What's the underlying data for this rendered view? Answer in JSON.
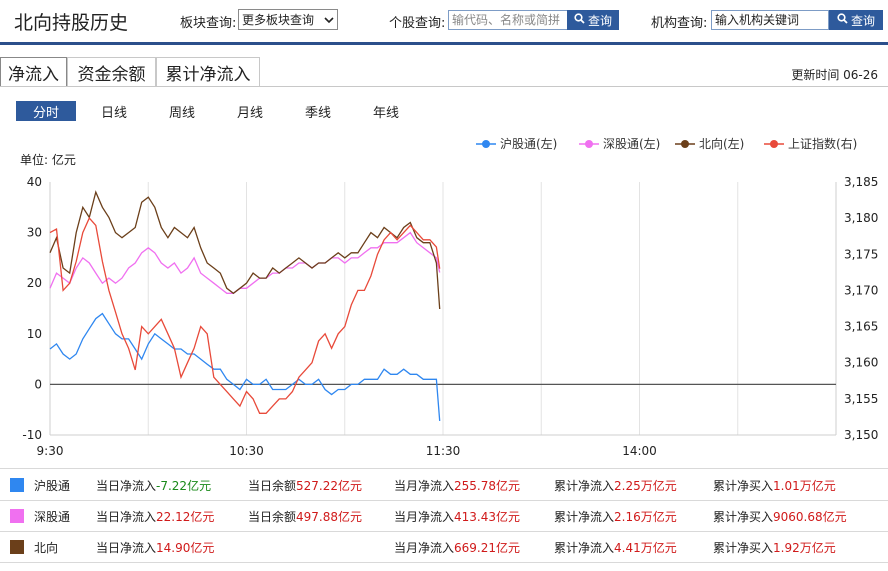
{
  "header": {
    "title": "北向持股历史",
    "sector_label": "板块查询:",
    "sector_value": "更多板块查询",
    "stock_label": "个股查询:",
    "stock_placeholder": "输代码、名称或简拼",
    "search_label": "查询",
    "inst_label": "机构查询:",
    "inst_placeholder": "输入机构关键词",
    "inst_search_label": "查询"
  },
  "tabs": [
    "净流入",
    "资金余额",
    "累计净流入"
  ],
  "update_time": "更新时间 06-26",
  "periods": [
    "分时",
    "日线",
    "周线",
    "月线",
    "季线",
    "年线"
  ],
  "legend": [
    "沪股通(左)",
    "深股通(左)",
    "北向(左)",
    "上证指数(右)"
  ],
  "colors": {
    "sh": "#2f87f0",
    "sz": "#f070f0",
    "north": "#6b3f1a",
    "index": "#e84a3a"
  },
  "chart_data": {
    "type": "line",
    "unit_label": "单位: 亿元",
    "left_ylim": [
      -10,
      40
    ],
    "left_ticks": [
      40,
      30,
      20,
      10,
      0,
      -10
    ],
    "right_ylim": [
      3150,
      3185
    ],
    "right_ticks": [
      "3,185",
      "3,180",
      "3,175",
      "3,170",
      "3,165",
      "3,160",
      "3,155",
      "3,150"
    ],
    "x_ticks": [
      "9:30",
      "10:30",
      "11:30",
      "14:00"
    ],
    "x_minutes_total": 240,
    "series": [
      {
        "name": "沪股通(左)",
        "axis": "left",
        "color_key": "sh",
        "x": [
          0,
          2,
          4,
          6,
          8,
          10,
          12,
          14,
          16,
          18,
          20,
          22,
          24,
          26,
          28,
          30,
          32,
          34,
          36,
          38,
          40,
          42,
          44,
          46,
          48,
          50,
          52,
          54,
          56,
          58,
          60,
          62,
          64,
          66,
          68,
          70,
          72,
          74,
          76,
          78,
          80,
          82,
          84,
          86,
          88,
          90,
          92,
          94,
          96,
          98,
          100,
          102,
          104,
          106,
          108,
          110,
          112,
          114,
          116,
          118,
          119
        ],
        "values": [
          7,
          8,
          6,
          5,
          6,
          9,
          11,
          13,
          14,
          12,
          10,
          9,
          9,
          7,
          5,
          8,
          10,
          9,
          8,
          7,
          7,
          6,
          6,
          5,
          4,
          3,
          3,
          1,
          0,
          -1,
          1,
          0,
          0,
          1,
          -1,
          -1,
          -1,
          0,
          1,
          0,
          0,
          1,
          -1,
          -2,
          -1,
          -1,
          0,
          0,
          1,
          1,
          1,
          3,
          2,
          2,
          3,
          2,
          2,
          1,
          1,
          1,
          -7.22
        ]
      },
      {
        "name": "深股通(左)",
        "axis": "left",
        "color_key": "sz",
        "x": [
          0,
          2,
          4,
          6,
          8,
          10,
          12,
          14,
          16,
          18,
          20,
          22,
          24,
          26,
          28,
          30,
          32,
          34,
          36,
          38,
          40,
          42,
          44,
          46,
          48,
          50,
          52,
          54,
          56,
          58,
          60,
          62,
          64,
          66,
          68,
          70,
          72,
          74,
          76,
          78,
          80,
          82,
          84,
          86,
          88,
          90,
          92,
          94,
          96,
          98,
          100,
          102,
          104,
          106,
          108,
          110,
          112,
          114,
          116,
          118,
          119
        ],
        "values": [
          19,
          22,
          21,
          20,
          23,
          25,
          24,
          22,
          20,
          21,
          20,
          21,
          23,
          24,
          26,
          27,
          26,
          24,
          23,
          24,
          22,
          23,
          25,
          22,
          21,
          20,
          19,
          18,
          18,
          19,
          19,
          20,
          21,
          21,
          22,
          22,
          23,
          23,
          24,
          24,
          23,
          24,
          24,
          25,
          25,
          24,
          25,
          25,
          26,
          27,
          27,
          28,
          28,
          28,
          29,
          30,
          28,
          27,
          26,
          25,
          22.12
        ]
      },
      {
        "name": "北向(左)",
        "axis": "left",
        "color_key": "north",
        "x": [
          0,
          2,
          4,
          6,
          8,
          10,
          12,
          14,
          16,
          18,
          20,
          22,
          24,
          26,
          28,
          30,
          32,
          34,
          36,
          38,
          40,
          42,
          44,
          46,
          48,
          50,
          52,
          54,
          56,
          58,
          60,
          62,
          64,
          66,
          68,
          70,
          72,
          74,
          76,
          78,
          80,
          82,
          84,
          86,
          88,
          90,
          92,
          94,
          96,
          98,
          100,
          102,
          104,
          106,
          108,
          110,
          112,
          114,
          116,
          118,
          119
        ],
        "values": [
          26,
          29,
          23,
          22,
          30,
          35,
          33,
          38,
          35,
          33,
          30,
          29,
          30,
          31,
          36,
          37,
          35,
          31,
          29,
          31,
          30,
          29,
          31,
          27,
          24,
          23,
          22,
          19,
          18,
          19,
          20,
          22,
          21,
          21,
          23,
          22,
          23,
          24,
          25,
          24,
          23,
          24,
          24,
          25,
          26,
          25,
          26,
          26,
          28,
          30,
          29,
          31,
          30,
          29,
          31,
          32,
          29,
          28,
          28,
          24,
          14.9
        ]
      },
      {
        "name": "上证指数(右)",
        "axis": "right",
        "color_key": "index",
        "x": [
          0,
          2,
          4,
          6,
          8,
          10,
          12,
          14,
          16,
          18,
          20,
          22,
          24,
          26,
          28,
          30,
          32,
          34,
          36,
          38,
          40,
          42,
          44,
          46,
          48,
          50,
          52,
          54,
          56,
          58,
          60,
          62,
          64,
          66,
          68,
          70,
          72,
          74,
          76,
          78,
          80,
          82,
          84,
          86,
          88,
          90,
          92,
          94,
          96,
          98,
          100,
          102,
          104,
          106,
          108,
          110,
          112,
          114,
          116,
          118,
          119
        ],
        "values": [
          3178,
          3178.5,
          3170,
          3171,
          3174,
          3178,
          3180,
          3179,
          3174,
          3170,
          3167,
          3164,
          3162,
          3159,
          3165,
          3164,
          3165,
          3166,
          3164,
          3162,
          3158,
          3160,
          3162,
          3165,
          3164,
          3158,
          3157,
          3156,
          3155,
          3154,
          3156,
          3155,
          3153,
          3153,
          3154,
          3155,
          3155,
          3156,
          3158,
          3159,
          3160,
          3163,
          3164,
          3162,
          3164,
          3165,
          3168,
          3170,
          3170,
          3172,
          3175,
          3177,
          3178,
          3177,
          3178,
          3179,
          3178,
          3177,
          3177,
          3176,
          3173
        ]
      }
    ]
  },
  "summary": [
    {
      "name": "沪股通",
      "color_key": "sh",
      "daily_net_label": "当日净流入",
      "daily_net": "-7.22亿元",
      "balance_label": "当日余额",
      "balance": "527.22亿元",
      "monthly_label": "当月净流入",
      "monthly": "255.78亿元",
      "cum_in_label": "累计净流入",
      "cum_in": "2.25万亿元",
      "cum_buy_label": "累计净买入",
      "cum_buy": "1.01万亿元"
    },
    {
      "name": "深股通",
      "color_key": "sz",
      "daily_net_label": "当日净流入",
      "daily_net": "22.12亿元",
      "balance_label": "当日余额",
      "balance": "497.88亿元",
      "monthly_label": "当月净流入",
      "monthly": "413.43亿元",
      "cum_in_label": "累计净流入",
      "cum_in": "2.16万亿元",
      "cum_buy_label": "累计净买入",
      "cum_buy": "9060.68亿元"
    },
    {
      "name": "北向",
      "color_key": "north",
      "daily_net_label": "当日净流入",
      "daily_net": "14.90亿元",
      "balance_label": "",
      "balance": "",
      "monthly_label": "当月净流入",
      "monthly": "669.21亿元",
      "cum_in_label": "累计净流入",
      "cum_in": "4.41万亿元",
      "cum_buy_label": "累计净买入",
      "cum_buy": "1.92万亿元"
    }
  ]
}
